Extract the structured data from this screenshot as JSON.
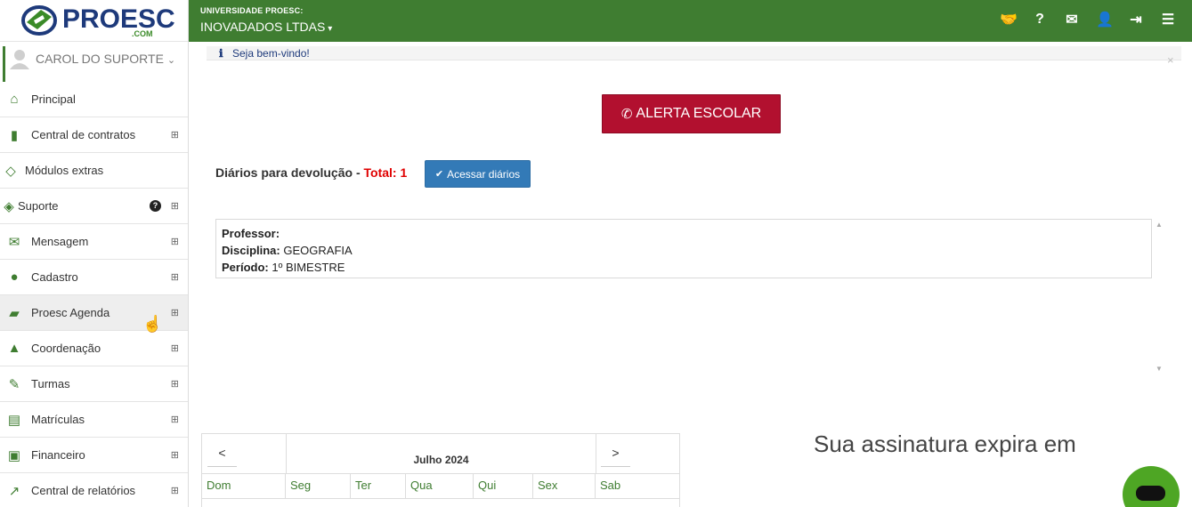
{
  "brand": {
    "logo_text": "PROESC",
    "logo_suffix": ".COM"
  },
  "topbar": {
    "school_name": "UNIVERSIDADE PROESC:",
    "company_name": "INOVADADOS LTDAS",
    "company_chevron": "▾",
    "icons": [
      "handshake-icon",
      "question-icon",
      "envelope-icon",
      "user-icon",
      "logout-icon",
      "menu-icon"
    ],
    "icon_glyphs": [
      "🤝",
      "?",
      "✉",
      "👤",
      "⇥",
      "☰"
    ]
  },
  "sidebar": {
    "user_name": "CAROL DO SUPORTE",
    "user_chevron": "⌄",
    "items": [
      {
        "label": "Principal",
        "icon": "home-icon",
        "glyph": "⌂",
        "expandable": false
      },
      {
        "label": "Central de contratos",
        "icon": "file-icon",
        "glyph": "▮",
        "expandable": true
      },
      {
        "label": "Módulos extras",
        "icon": "diamond-icon",
        "glyph": "◇",
        "expandable": false
      },
      {
        "label": "Suporte",
        "icon": "ticket-icon",
        "glyph": "◈",
        "expandable": true,
        "help": "?"
      },
      {
        "label": "Mensagem",
        "icon": "envelope-icon",
        "glyph": "✉",
        "expandable": true
      },
      {
        "label": "Cadastro",
        "icon": "users-icon",
        "glyph": "●",
        "expandable": true
      },
      {
        "label": "Proesc Agenda",
        "icon": "book-icon",
        "glyph": "▰",
        "expandable": true
      },
      {
        "label": "Coordenação",
        "icon": "graduation-cap-icon",
        "glyph": "▲",
        "expandable": true
      },
      {
        "label": "Turmas",
        "icon": "pencil-icon",
        "glyph": "✎",
        "expandable": true
      },
      {
        "label": "Matrículas",
        "icon": "open-book-icon",
        "glyph": "▤",
        "expandable": true
      },
      {
        "label": "Financeiro",
        "icon": "money-icon",
        "glyph": "▣",
        "expandable": true
      },
      {
        "label": "Central de relatórios",
        "icon": "chart-line-icon",
        "glyph": "↗",
        "expandable": true
      }
    ],
    "expand_glyph": "⊞"
  },
  "main": {
    "welcome_icon": "ℹ",
    "welcome_text": "Seja bem-vindo!",
    "close_glyph": "×",
    "alert_icon": "✆",
    "alert_button": "ALERTA ESCOLAR",
    "diarios_label": "Diários para devolução -",
    "diarios_total_label": "Total: 1",
    "access_icon": "✔",
    "access_button": "Acessar diários",
    "info": {
      "professor_label": "Professor:",
      "professor_value": "",
      "disciplina_label": "Disciplina:",
      "disciplina_value": "GEOGRAFIA",
      "periodo_label": "Período:",
      "periodo_value": "1º BIMESTRE"
    },
    "scroll_up": "▲",
    "scroll_down": "▼",
    "calendar": {
      "prev": "<",
      "next": ">",
      "month": "Julho 2024",
      "days": [
        "Dom",
        "Seg",
        "Ter",
        "Qua",
        "Qui",
        "Sex",
        "Sab"
      ]
    },
    "subscription_text": "Sua assinatura expira em"
  },
  "colors": {
    "brand_green": "#3f7d31",
    "alert_red": "#b2102f",
    "button_blue": "#337ab7",
    "total_red": "#e00000",
    "chat_green": "#4ea624"
  }
}
